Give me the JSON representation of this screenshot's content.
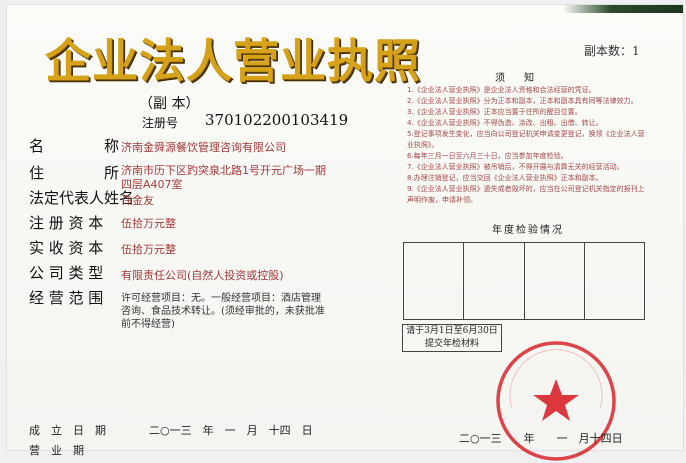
{
  "document": {
    "title": "企业法人营业执照",
    "copy_label": "（副 本）",
    "copy_number": "副本数：1",
    "registration_label": "注册号",
    "registration_number": "370102200103419"
  },
  "fields": [
    {
      "label": "名　　　　称",
      "value": "济南金舜源餐饮管理咨询有限公司"
    },
    {
      "label": "住　　　　所",
      "value": "济南市历下区趵突泉北路1号开元广场一期四层A407室"
    },
    {
      "label": "法定代表人姓名",
      "value": "许金友"
    },
    {
      "label": "注 册 资 本",
      "value": "伍拾万元整"
    },
    {
      "label": "实 收 资 本",
      "value": "伍拾万元整"
    },
    {
      "label": "公 司 类 型",
      "value": "有限责任公司(自然人投资或控股)"
    },
    {
      "label": "经 营 范 围",
      "value": "许可经营项目：无。一般经营项目：酒店管理咨询、食品技术转让。(须经审批的，未获批准前不得经营)"
    }
  ],
  "footer": {
    "established_label": "成　立　日　期",
    "established_value": "二○一三　年　一　月　十四　日",
    "term_label": "营　业　期",
    "issue_date": "二○一三　　年　　一　月十四日"
  },
  "notice": {
    "title": "须 知",
    "items": [
      "1.《企业法人营业执照》是企业法人资格和合法经营的凭证。",
      "2.《企业法人营业执照》分为正本和副本，正本和副本具有同等法律效力。",
      "3.《企业法人营业执照》正本应当置于住所的醒目位置。",
      "4.《企业法人营业执照》不得伪造、涂改、出租、出借、转让。",
      "5.登记事项发生变化，应当向公司登记机关申请变更登记，换领《企业法人营业执照》。",
      "6.每年三月一日至六月三十日，应当参加年度检验。",
      "7.《企业法人营业执照》被吊销后，不得开展与清算无关的经营活动。",
      "8.办理注销登记，应当交回《企业法人营业执照》正本和副本。",
      "9.《企业法人营业执照》遗失或者毁坏的，应当在公司登记机关指定的报刊上声明作废，申请补领。"
    ]
  },
  "annual_inspection": {
    "title": "年度检验情况",
    "stamp_line1": "请于3月1日至6月30日",
    "stamp_line2": "提交年检材料"
  },
  "seal_text": "济南市工商行政管理局历下分局",
  "colors": {
    "title_gold": "#d6a21a",
    "seal_red": "#d8232a",
    "value_red": "#a33a3a"
  }
}
